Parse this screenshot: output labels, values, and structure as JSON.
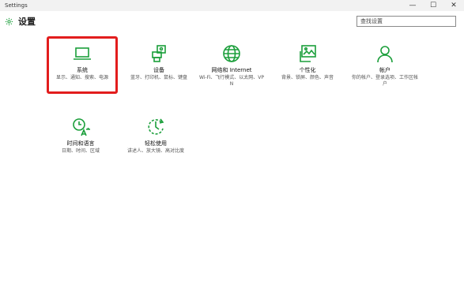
{
  "window": {
    "title": "Settings",
    "minimize": "—",
    "maximize": "☐",
    "close": "✕"
  },
  "header": {
    "title": "设置",
    "search_placeholder": "查找设置"
  },
  "tiles": [
    {
      "name": "系统",
      "desc": "显示、通知、搜索、电源",
      "icon": "laptop-icon"
    },
    {
      "name": "设备",
      "desc": "蓝牙、打印机、鼠标、键盘",
      "icon": "devices-icon"
    },
    {
      "name": "网络和 Internet",
      "desc": "Wi-Fi、飞行模式、以太网、VPN",
      "icon": "globe-icon"
    },
    {
      "name": "个性化",
      "desc": "背景、锁屏、颜色、声音",
      "icon": "personalization-icon"
    },
    {
      "name": "帐户",
      "desc": "你的帐户、登录选项、工作区帐户",
      "icon": "person-icon"
    },
    {
      "name": "时间和语言",
      "desc": "日期、时间、区域",
      "icon": "time-language-icon"
    },
    {
      "name": "轻松使用",
      "desc": "讲述人、放大镜、高对比度",
      "icon": "ease-of-access-icon"
    }
  ],
  "colors": {
    "accent": "#1a9e3a",
    "highlight": "#e21d1d"
  }
}
